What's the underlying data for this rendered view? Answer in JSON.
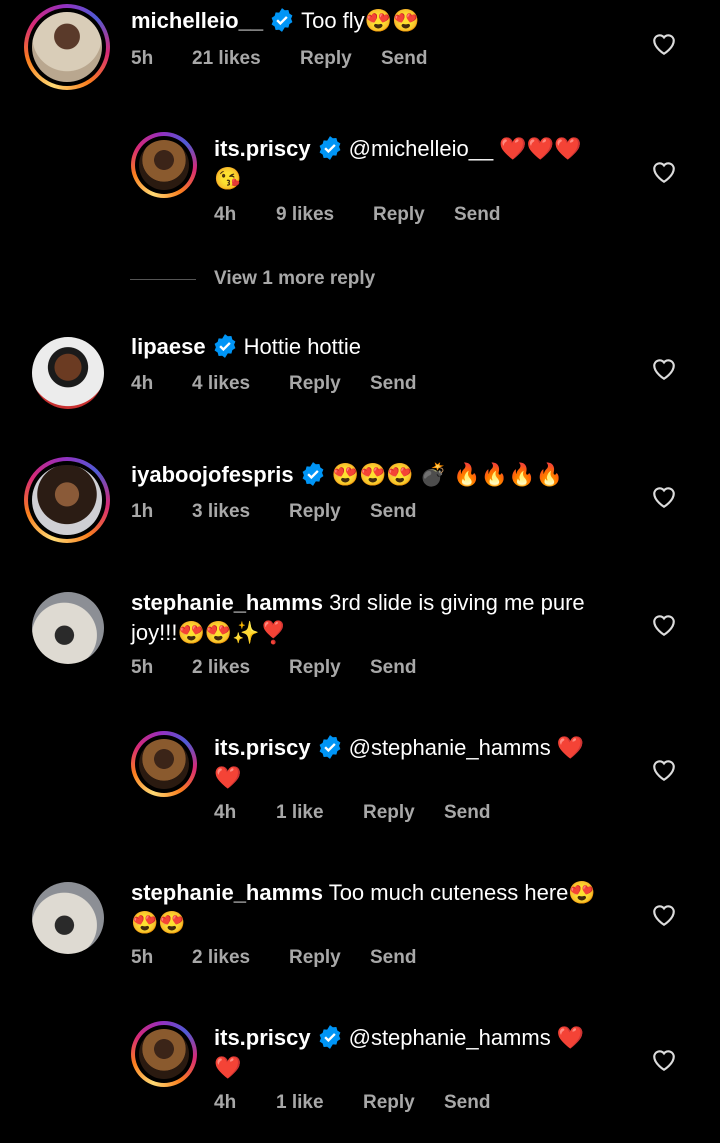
{
  "comments": [
    {
      "username": "michelleio__",
      "text": "Too fly😍😍",
      "text2": "",
      "time": "5h",
      "likes": "21 likes",
      "reply": "Reply",
      "send": "Send"
    },
    {
      "username": "its.priscy",
      "text": "@michelleio__ ❤️❤️❤️",
      "text2": "😘",
      "time": "4h",
      "likes": "9 likes",
      "reply": "Reply",
      "send": "Send"
    },
    {
      "username": "lipaese",
      "text": "Hottie hottie",
      "text2": "",
      "time": "4h",
      "likes": "4 likes",
      "reply": "Reply",
      "send": "Send"
    },
    {
      "username": "iyaboojofespris",
      "text": "😍😍😍 💣 🔥🔥🔥🔥",
      "text2": "",
      "time": "1h",
      "likes": "3 likes",
      "reply": "Reply",
      "send": "Send"
    },
    {
      "username": "stephanie_hamms",
      "text": "3rd slide is giving me pure",
      "text2": "joy!!!😍😍✨❣️",
      "time": "5h",
      "likes": "2 likes",
      "reply": "Reply",
      "send": "Send"
    },
    {
      "username": "its.priscy",
      "text": "@stephanie_hamms ❤️",
      "text2": "❤️",
      "time": "4h",
      "likes": "1 like",
      "reply": "Reply",
      "send": "Send"
    },
    {
      "username": "stephanie_hamms",
      "text": "Too much cuteness here😍",
      "text2": "😍😍",
      "time": "5h",
      "likes": "2 likes",
      "reply": "Reply",
      "send": "Send"
    },
    {
      "username": "its.priscy",
      "text": "@stephanie_hamms ❤️",
      "text2": "❤️",
      "time": "4h",
      "likes": "1 like",
      "reply": "Reply",
      "send": "Send"
    }
  ],
  "view_more_replies": "View 1 more reply",
  "icons": {
    "verified": "verified-badge-icon",
    "like": "heart-outline-icon"
  },
  "colors": {
    "background": "#000000",
    "verified": "#0095f6",
    "meta": "#a8a8a8"
  }
}
